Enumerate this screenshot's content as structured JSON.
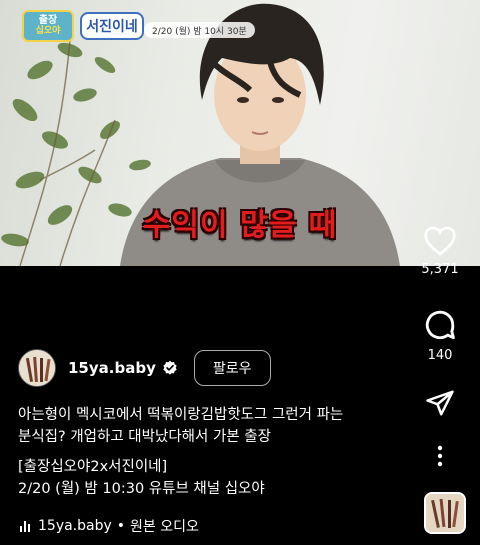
{
  "video": {
    "logo_left_line1": "출장",
    "logo_left_line2": "십오야",
    "logo_right": "서진이네",
    "broadcast_time": "2/20 (월) 밤 10시 30분",
    "caption": "수익이 많을 때"
  },
  "actions": {
    "like_icon": "heart-icon",
    "like_count": "5,371",
    "comment_icon": "comment-bubble-icon",
    "comment_count": "140",
    "share_icon": "send-icon",
    "more_icon": "more-vertical-icon"
  },
  "channel": {
    "username": "15ya.baby",
    "verified_icon": "verified-badge-icon",
    "follow_label": "팔로우"
  },
  "description": {
    "line1": "아는형이 멕시코에서 떡볶이랑김밥핫도그 그런거 파는",
    "line2": "분식집? 개업하고 대박났다해서 가본 출장",
    "line3": "[출장십오야2x서진이네]",
    "line4": "2/20 (월) 밤 10:30 유튜브 채널 십오야"
  },
  "audio": {
    "icon": "audio-bars-icon",
    "username": "15ya.baby",
    "separator": "•",
    "label": "원본 오디오"
  },
  "colors": {
    "caption_red": "#e21d1d",
    "verified_blue": "#ffffff",
    "background": "#000000"
  }
}
